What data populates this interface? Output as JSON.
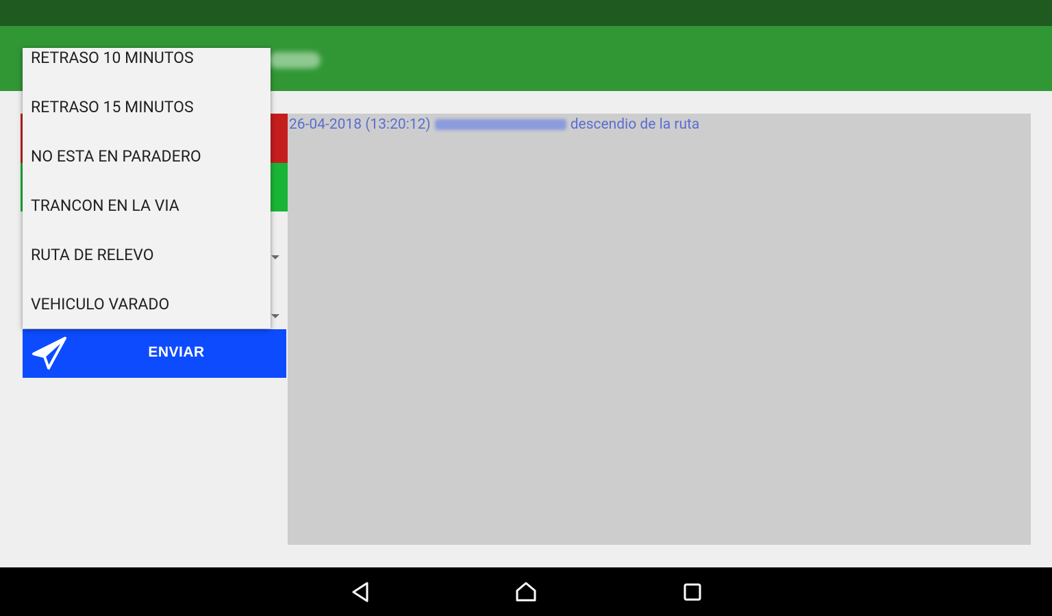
{
  "colors": {
    "status_bar": "#1f5a20",
    "app_bar": "#319735",
    "strip_red": "#c41e1e",
    "strip_green": "#19b537",
    "send_button": "#0d4bff",
    "log_panel": "#cdcdcd",
    "log_text": "#5a6ed0"
  },
  "dropdown": {
    "items": [
      {
        "label": "RETRASO 10 MINUTOS"
      },
      {
        "label": "RETRASO 15 MINUTOS"
      },
      {
        "label": "NO ESTA EN PARADERO"
      },
      {
        "label": "TRANCON EN LA VIA"
      },
      {
        "label": "RUTA DE RELEVO"
      },
      {
        "label": "VEHICULO VARADO"
      }
    ]
  },
  "send_button": {
    "label": "ENVIAR",
    "icon": "paper-plane-icon"
  },
  "log": {
    "entries": [
      {
        "timestamp": "26-04-2018 (13:20:12)",
        "message": "descendio de la ruta"
      }
    ]
  },
  "nav_bar": {
    "icons": [
      "back-icon",
      "home-icon",
      "recents-icon"
    ]
  }
}
